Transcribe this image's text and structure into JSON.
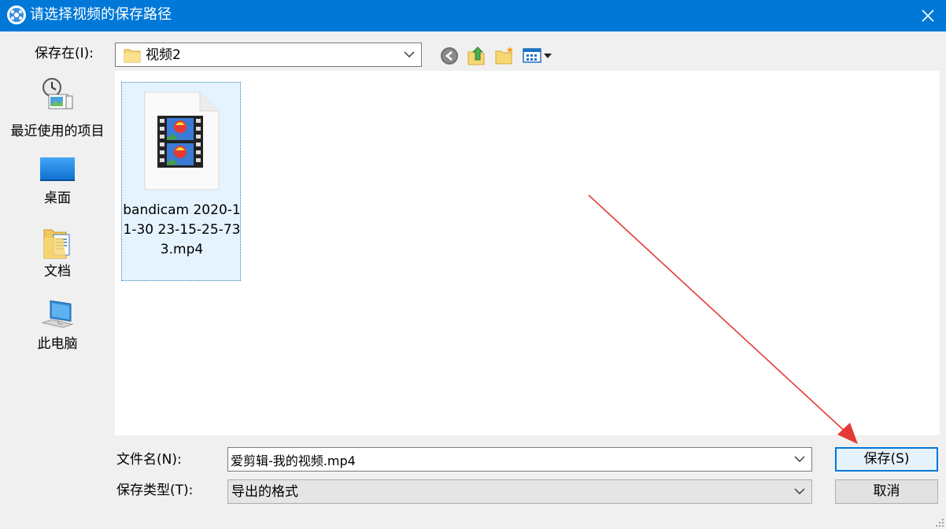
{
  "window": {
    "title": "请选择视频的保存路径"
  },
  "toolbar": {
    "save_in_label": "保存在(I):",
    "current_folder": "视频2"
  },
  "places": [
    {
      "label": "最近使用的项目",
      "icon": "recent-items-icon"
    },
    {
      "label": "桌面",
      "icon": "desktop-icon"
    },
    {
      "label": "文档",
      "icon": "documents-icon"
    },
    {
      "label": "此电脑",
      "icon": "this-pc-icon"
    }
  ],
  "files": [
    {
      "label": "bandicam 2020-11-30 23-15-25-733.mp4",
      "icon": "video-file-icon"
    }
  ],
  "form": {
    "file_name_label": "文件名(N):",
    "file_name_value": "爱剪辑-我的视频.mp4",
    "file_type_label": "保存类型(T):",
    "file_type_value": "导出的格式"
  },
  "buttons": {
    "save": "保存(S)",
    "cancel": "取消"
  },
  "colors": {
    "titlebar": "#0078d7",
    "selection": "#e5f3ff",
    "annotation_arrow": "#e53935"
  }
}
